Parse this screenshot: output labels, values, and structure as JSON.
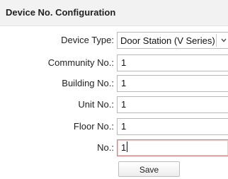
{
  "header": {
    "title": "Device No. Configuration"
  },
  "form": {
    "device_type": {
      "label": "Device Type:",
      "value": "Door Station (V Series)"
    },
    "community": {
      "label": "Community No.:",
      "value": "1"
    },
    "building": {
      "label": "Building No.:",
      "value": "1"
    },
    "unit": {
      "label": "Unit No.:",
      "value": "1"
    },
    "floor": {
      "label": "Floor No.:",
      "value": "1"
    },
    "no": {
      "label": "No.:",
      "value": "1"
    }
  },
  "actions": {
    "save_label": "Save"
  },
  "icons": {
    "dropdown": "chevron-down-icon"
  },
  "colors": {
    "header_bg": "#f2f2f2",
    "active_border": "#d97f7f"
  }
}
